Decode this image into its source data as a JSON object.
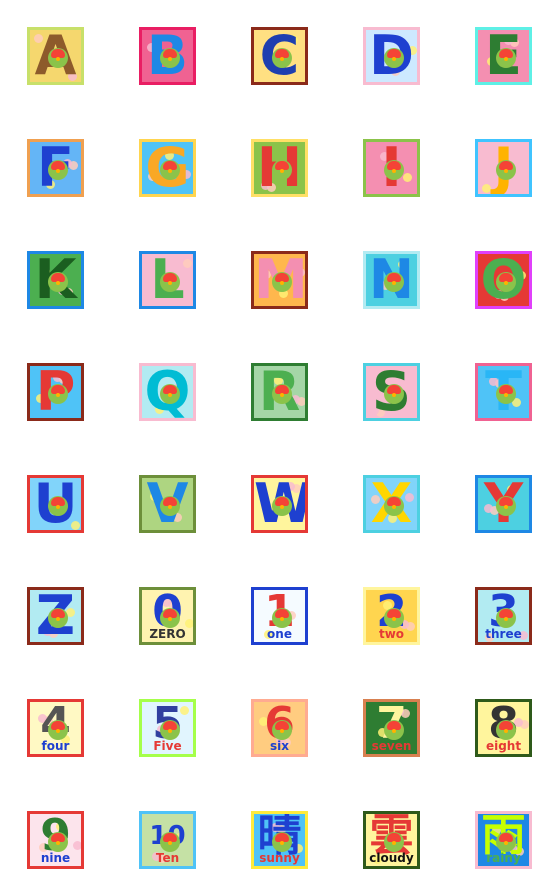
{
  "tiles": [
    {
      "glyph": "A",
      "word": "",
      "border": "#c8e06a",
      "bg": "#f5d76e",
      "color": "#8d5a2b"
    },
    {
      "glyph": "B",
      "word": "",
      "border": "#e91e63",
      "bg": "#f06292",
      "color": "#1e88e5"
    },
    {
      "glyph": "C",
      "word": "",
      "border": "#8b2a1a",
      "bg": "#ffe082",
      "color": "#1e3fb0"
    },
    {
      "glyph": "D",
      "word": "",
      "border": "#f8bbd0",
      "bg": "#cde9ff",
      "color": "#1e40d0"
    },
    {
      "glyph": "E",
      "word": "",
      "border": "#5ef0e6",
      "bg": "#f48fb1",
      "color": "#2e7d32"
    },
    {
      "glyph": "F",
      "word": "",
      "border": "#f0a050",
      "bg": "#64b5f6",
      "color": "#1e40d0"
    },
    {
      "glyph": "G",
      "word": "",
      "border": "#ffd54f",
      "bg": "#4fc3f7",
      "color": "#f9a825"
    },
    {
      "glyph": "H",
      "word": "",
      "border": "#ffe066",
      "bg": "#8bc34a",
      "color": "#e53935"
    },
    {
      "glyph": "I",
      "word": "",
      "border": "#8bc34a",
      "bg": "#f48fb1",
      "color": "#e53935"
    },
    {
      "glyph": "J",
      "word": "",
      "border": "#40c4ff",
      "bg": "#f8bbd0",
      "color": "#ffb300"
    },
    {
      "glyph": "K",
      "word": "",
      "border": "#1e88e5",
      "bg": "#4caf50",
      "color": "#1b5e20"
    },
    {
      "glyph": "L",
      "word": "",
      "border": "#1e88e5",
      "bg": "#f8bbd0",
      "color": "#4caf50"
    },
    {
      "glyph": "M",
      "word": "",
      "border": "#8b2a1a",
      "bg": "#ffb74d",
      "color": "#f48fb1"
    },
    {
      "glyph": "N",
      "word": "",
      "border": "#b2ebf2",
      "bg": "#4dd0e1",
      "color": "#1e88e5"
    },
    {
      "glyph": "O",
      "word": "",
      "border": "#e040fb",
      "bg": "#e53935",
      "color": "#4caf50"
    },
    {
      "glyph": "P",
      "word": "",
      "border": "#8b2a1a",
      "bg": "#4fc3f7",
      "color": "#e53935"
    },
    {
      "glyph": "Q",
      "word": "",
      "border": "#f8bbd0",
      "bg": "#b2ebf2",
      "color": "#00bcd4"
    },
    {
      "glyph": "R",
      "word": "",
      "border": "#2e7d32",
      "bg": "#a5d6a7",
      "color": "#4caf50"
    },
    {
      "glyph": "S",
      "word": "",
      "border": "#4dd0e1",
      "bg": "#f8bbd0",
      "color": "#2e7d32"
    },
    {
      "glyph": "T",
      "word": "",
      "border": "#f06292",
      "bg": "#4fc3f7",
      "color": "#29b6f6"
    },
    {
      "glyph": "U",
      "word": "",
      "border": "#e53935",
      "bg": "#81d4fa",
      "color": "#1e40d0"
    },
    {
      "glyph": "V",
      "word": "",
      "border": "#6d8f3a",
      "bg": "#aed581",
      "color": "#1e88e5"
    },
    {
      "glyph": "W",
      "word": "",
      "border": "#e53935",
      "bg": "#fff59d",
      "color": "#1e40d0"
    },
    {
      "glyph": "X",
      "word": "",
      "border": "#4dd0e1",
      "bg": "#81d4fa",
      "color": "#ffd600"
    },
    {
      "glyph": "Y",
      "word": "",
      "border": "#1e88e5",
      "bg": "#4dd0e1",
      "color": "#e53935"
    },
    {
      "glyph": "Z",
      "word": "",
      "border": "#8b2a1a",
      "bg": "#b2ebf2",
      "color": "#1e40d0"
    },
    {
      "glyph": "0",
      "word": "ZERO",
      "border": "#6d8f3a",
      "bg": "#fff3b0",
      "color": "#1e40d0",
      "wordColor": "#333333"
    },
    {
      "glyph": "1",
      "word": "one",
      "border": "#1e40d0",
      "bg": "#f5fbff",
      "color": "#e53935",
      "wordColor": "#1e40d0"
    },
    {
      "glyph": "2",
      "word": "two",
      "border": "#fff59d",
      "bg": "#ffd54f",
      "color": "#1e40d0",
      "wordColor": "#e53935"
    },
    {
      "glyph": "3",
      "word": "three",
      "border": "#8b2a1a",
      "bg": "#b2ebf2",
      "color": "#1e40d0",
      "wordColor": "#1e40d0"
    },
    {
      "glyph": "4",
      "word": "four",
      "border": "#e53935",
      "bg": "#fff9c4",
      "color": "#555555",
      "wordColor": "#1e40d0"
    },
    {
      "glyph": "5",
      "word": "Five",
      "border": "#a5ff4a",
      "bg": "#e1f5fe",
      "color": "#303f9f",
      "wordColor": "#e53935"
    },
    {
      "glyph": "6",
      "word": "six",
      "border": "#ffab91",
      "bg": "#ffcc80",
      "color": "#e53935",
      "wordColor": "#1e40d0"
    },
    {
      "glyph": "7",
      "word": "seven",
      "border": "#d88050",
      "bg": "#2e7d32",
      "color": "#fff59d",
      "wordColor": "#e53935"
    },
    {
      "glyph": "8",
      "word": "eight",
      "border": "#2e5a1a",
      "bg": "#fff59d",
      "color": "#333333",
      "wordColor": "#e53935"
    },
    {
      "glyph": "9",
      "word": "nine",
      "border": "#e53935",
      "bg": "#fce4ec",
      "color": "#2e7d32",
      "wordColor": "#1e40d0"
    },
    {
      "glyph": "10",
      "word": "Ten",
      "border": "#4fc3f7",
      "bg": "#c5e1a5",
      "color": "#1e40d0",
      "wordColor": "#e53935"
    },
    {
      "glyph": "晴",
      "word": "sunny",
      "border": "#ffeb3b",
      "bg": "#4fc3f7",
      "color": "#1e40d0",
      "wordColor": "#e53935"
    },
    {
      "glyph": "雲",
      "word": "cloudy",
      "border": "#2e5a1a",
      "bg": "#fff59d",
      "color": "#e53935",
      "wordColor": "#111111"
    },
    {
      "glyph": "雨",
      "word": "rainy",
      "border": "#f8bbd0",
      "bg": "#1e88e5",
      "color": "#c6ff00",
      "wordColor": "#4caf50"
    }
  ]
}
